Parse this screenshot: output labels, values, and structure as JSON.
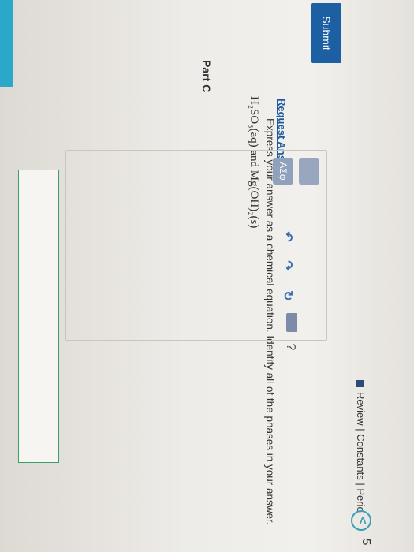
{
  "header": {
    "links_text": "Review | Constants | Perio",
    "nav_glyph": "<",
    "page_number": "5"
  },
  "actions": {
    "submit_label": "Submit",
    "request_answer_label": "Request Answer"
  },
  "part": {
    "title": "Part C",
    "reaction": "H₂SO₃(aq) and Mg(OH)₂(s)",
    "instructions": "Express your answer as a chemical equation. Identify all of the phases in your answer."
  },
  "toolbar": {
    "greek_label": "ΑΣφ",
    "undo_glyph": "↶",
    "redo_glyph": "↷",
    "reset_glyph": "↻",
    "help_glyph": "?"
  },
  "colors": {
    "submit_bg": "#1d5fa3",
    "link": "#1e5aa0",
    "answer_border": "#3aa06a",
    "edge_strip": "#2aa7c9"
  }
}
